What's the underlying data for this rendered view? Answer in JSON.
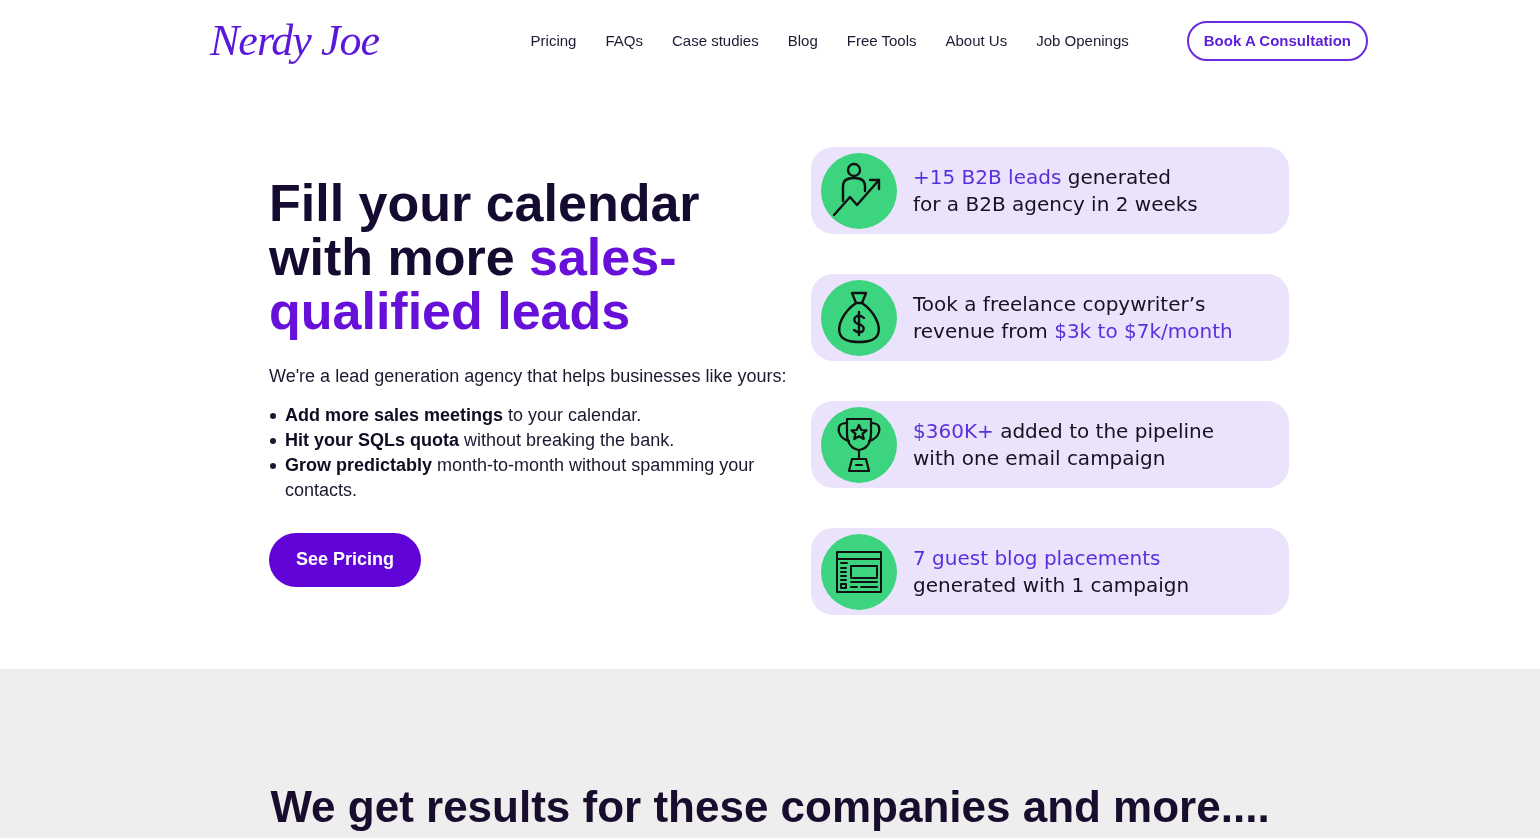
{
  "header": {
    "logo": "Nerdy Joe",
    "nav": [
      "Pricing",
      "FAQs",
      "Case studies",
      "Blog",
      "Free Tools",
      "About Us",
      "Job Openings"
    ],
    "cta": "Book A Consultation"
  },
  "hero": {
    "heading": [
      {
        "text": "Fill your calendar with more ",
        "highlight": false
      },
      {
        "text": "sales-qualified leads",
        "highlight": true
      }
    ],
    "intro": "We're a lead generation agency that helps businesses like yours:",
    "bullets": [
      "**Add more sales meetings** to your calendar.",
      "**Hit your SQLs quota** without breaking the bank.",
      "**Grow predictably** month-to-month without spamming your contacts."
    ],
    "button": "See Pricing"
  },
  "results": [
    {
      "lines": [
        [
          {
            "text": "+15 B2B leads",
            "highlight": true
          },
          {
            "text": " generated",
            "highlight": false
          }
        ],
        [
          {
            "text": "for a B2B agency in 2 weeks",
            "highlight": false
          }
        ]
      ]
    },
    {
      "lines": [
        [
          {
            "text": "Took a freelance copywriter’s",
            "highlight": false
          }
        ],
        [
          {
            "text": "revenue from ",
            "highlight": false
          },
          {
            "text": "$3k to $7k/month",
            "highlight": true
          }
        ]
      ]
    },
    {
      "lines": [
        [
          {
            "text": "$360K+",
            "highlight": true
          },
          {
            "text": " added to the pipeline",
            "highlight": false
          }
        ],
        [
          {
            "text": "with one email campaign",
            "highlight": false
          }
        ]
      ]
    },
    {
      "lines": [
        [
          {
            "text": "7 guest blog placements",
            "highlight": true
          }
        ],
        [
          {
            "text": "generated with 1 campaign",
            "highlight": false
          }
        ]
      ]
    }
  ],
  "clients": {
    "heading": "We get results for these companies and more...."
  }
}
